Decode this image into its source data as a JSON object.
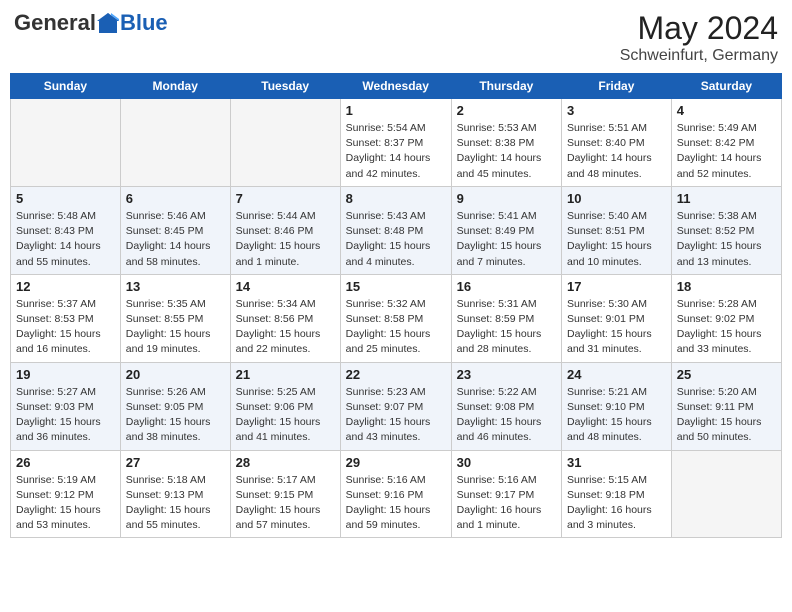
{
  "header": {
    "logo_general": "General",
    "logo_blue": "Blue",
    "month": "May 2024",
    "location": "Schweinfurt, Germany"
  },
  "weekdays": [
    "Sunday",
    "Monday",
    "Tuesday",
    "Wednesday",
    "Thursday",
    "Friday",
    "Saturday"
  ],
  "weeks": [
    [
      {
        "day": "",
        "info": ""
      },
      {
        "day": "",
        "info": ""
      },
      {
        "day": "",
        "info": ""
      },
      {
        "day": "1",
        "info": "Sunrise: 5:54 AM\nSunset: 8:37 PM\nDaylight: 14 hours\nand 42 minutes."
      },
      {
        "day": "2",
        "info": "Sunrise: 5:53 AM\nSunset: 8:38 PM\nDaylight: 14 hours\nand 45 minutes."
      },
      {
        "day": "3",
        "info": "Sunrise: 5:51 AM\nSunset: 8:40 PM\nDaylight: 14 hours\nand 48 minutes."
      },
      {
        "day": "4",
        "info": "Sunrise: 5:49 AM\nSunset: 8:42 PM\nDaylight: 14 hours\nand 52 minutes."
      }
    ],
    [
      {
        "day": "5",
        "info": "Sunrise: 5:48 AM\nSunset: 8:43 PM\nDaylight: 14 hours\nand 55 minutes."
      },
      {
        "day": "6",
        "info": "Sunrise: 5:46 AM\nSunset: 8:45 PM\nDaylight: 14 hours\nand 58 minutes."
      },
      {
        "day": "7",
        "info": "Sunrise: 5:44 AM\nSunset: 8:46 PM\nDaylight: 15 hours\nand 1 minute."
      },
      {
        "day": "8",
        "info": "Sunrise: 5:43 AM\nSunset: 8:48 PM\nDaylight: 15 hours\nand 4 minutes."
      },
      {
        "day": "9",
        "info": "Sunrise: 5:41 AM\nSunset: 8:49 PM\nDaylight: 15 hours\nand 7 minutes."
      },
      {
        "day": "10",
        "info": "Sunrise: 5:40 AM\nSunset: 8:51 PM\nDaylight: 15 hours\nand 10 minutes."
      },
      {
        "day": "11",
        "info": "Sunrise: 5:38 AM\nSunset: 8:52 PM\nDaylight: 15 hours\nand 13 minutes."
      }
    ],
    [
      {
        "day": "12",
        "info": "Sunrise: 5:37 AM\nSunset: 8:53 PM\nDaylight: 15 hours\nand 16 minutes."
      },
      {
        "day": "13",
        "info": "Sunrise: 5:35 AM\nSunset: 8:55 PM\nDaylight: 15 hours\nand 19 minutes."
      },
      {
        "day": "14",
        "info": "Sunrise: 5:34 AM\nSunset: 8:56 PM\nDaylight: 15 hours\nand 22 minutes."
      },
      {
        "day": "15",
        "info": "Sunrise: 5:32 AM\nSunset: 8:58 PM\nDaylight: 15 hours\nand 25 minutes."
      },
      {
        "day": "16",
        "info": "Sunrise: 5:31 AM\nSunset: 8:59 PM\nDaylight: 15 hours\nand 28 minutes."
      },
      {
        "day": "17",
        "info": "Sunrise: 5:30 AM\nSunset: 9:01 PM\nDaylight: 15 hours\nand 31 minutes."
      },
      {
        "day": "18",
        "info": "Sunrise: 5:28 AM\nSunset: 9:02 PM\nDaylight: 15 hours\nand 33 minutes."
      }
    ],
    [
      {
        "day": "19",
        "info": "Sunrise: 5:27 AM\nSunset: 9:03 PM\nDaylight: 15 hours\nand 36 minutes."
      },
      {
        "day": "20",
        "info": "Sunrise: 5:26 AM\nSunset: 9:05 PM\nDaylight: 15 hours\nand 38 minutes."
      },
      {
        "day": "21",
        "info": "Sunrise: 5:25 AM\nSunset: 9:06 PM\nDaylight: 15 hours\nand 41 minutes."
      },
      {
        "day": "22",
        "info": "Sunrise: 5:23 AM\nSunset: 9:07 PM\nDaylight: 15 hours\nand 43 minutes."
      },
      {
        "day": "23",
        "info": "Sunrise: 5:22 AM\nSunset: 9:08 PM\nDaylight: 15 hours\nand 46 minutes."
      },
      {
        "day": "24",
        "info": "Sunrise: 5:21 AM\nSunset: 9:10 PM\nDaylight: 15 hours\nand 48 minutes."
      },
      {
        "day": "25",
        "info": "Sunrise: 5:20 AM\nSunset: 9:11 PM\nDaylight: 15 hours\nand 50 minutes."
      }
    ],
    [
      {
        "day": "26",
        "info": "Sunrise: 5:19 AM\nSunset: 9:12 PM\nDaylight: 15 hours\nand 53 minutes."
      },
      {
        "day": "27",
        "info": "Sunrise: 5:18 AM\nSunset: 9:13 PM\nDaylight: 15 hours\nand 55 minutes."
      },
      {
        "day": "28",
        "info": "Sunrise: 5:17 AM\nSunset: 9:15 PM\nDaylight: 15 hours\nand 57 minutes."
      },
      {
        "day": "29",
        "info": "Sunrise: 5:16 AM\nSunset: 9:16 PM\nDaylight: 15 hours\nand 59 minutes."
      },
      {
        "day": "30",
        "info": "Sunrise: 5:16 AM\nSunset: 9:17 PM\nDaylight: 16 hours\nand 1 minute."
      },
      {
        "day": "31",
        "info": "Sunrise: 5:15 AM\nSunset: 9:18 PM\nDaylight: 16 hours\nand 3 minutes."
      },
      {
        "day": "",
        "info": ""
      }
    ]
  ]
}
